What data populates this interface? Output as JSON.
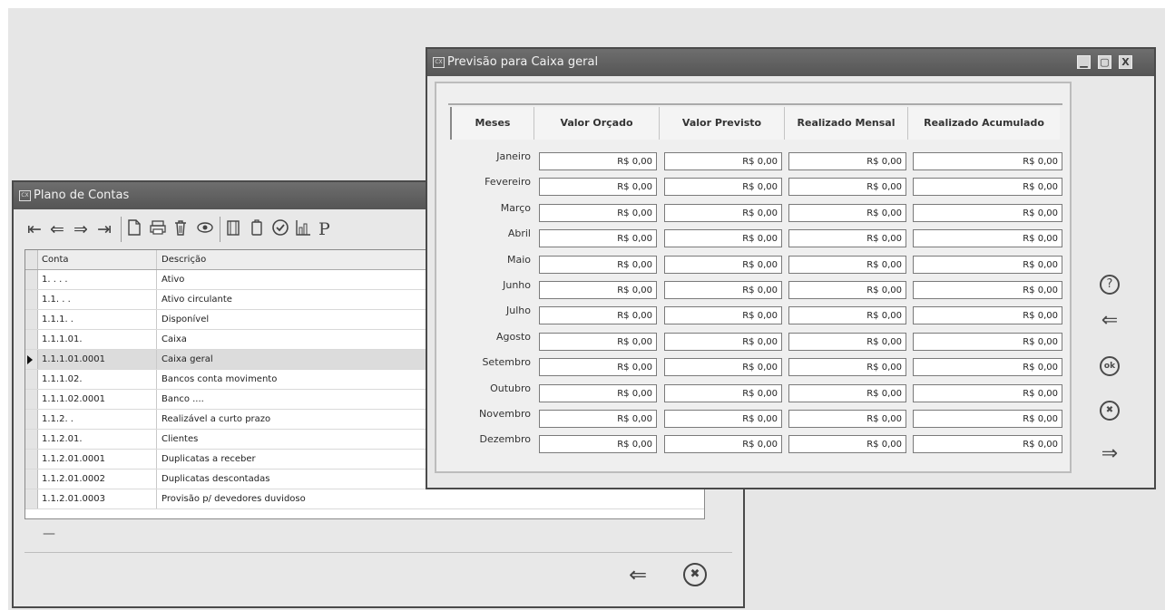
{
  "plano": {
    "title": "Plano de Contas",
    "columns": {
      "conta": "Conta",
      "descricao": "Descrição"
    },
    "rows": [
      {
        "conta": "1. . . .",
        "descricao": "Ativo"
      },
      {
        "conta": "1.1. . .",
        "descricao": "Ativo circulante"
      },
      {
        "conta": "1.1.1. .",
        "descricao": "Disponível"
      },
      {
        "conta": "1.1.1.01.",
        "descricao": "Caixa"
      },
      {
        "conta": "1.1.1.01.0001",
        "descricao": "Caixa geral"
      },
      {
        "conta": "1.1.1.02.",
        "descricao": "Bancos conta movimento"
      },
      {
        "conta": "1.1.1.02.0001",
        "descricao": "Banco ...."
      },
      {
        "conta": "1.1.2. .",
        "descricao": "Realizável a curto prazo"
      },
      {
        "conta": "1.1.2.01.",
        "descricao": "Clientes"
      },
      {
        "conta": "1.1.2.01.0001",
        "descricao": "Duplicatas a receber"
      },
      {
        "conta": "1.1.2.01.0002",
        "descricao": "Duplicatas descontadas"
      },
      {
        "conta": "1.1.2.01.0003",
        "descricao": "Provisão p/ devedores duvidoso"
      }
    ],
    "selected_index": 4,
    "toolbar_p": "P",
    "footer_dash": "—"
  },
  "previsao": {
    "title": "Previsão para Caixa geral",
    "headers": {
      "meses": "Meses",
      "orcado": "Valor Orçado",
      "previsto": "Valor Previsto",
      "mensal": "Realizado Mensal",
      "acumulado": "Realizado Acumulado"
    },
    "months": [
      {
        "name": "Janeiro",
        "orcado": "R$ 0,00",
        "previsto": "R$ 0,00",
        "mensal": "R$ 0,00",
        "acumulado": "R$ 0,00"
      },
      {
        "name": "Fevereiro",
        "orcado": "R$ 0,00",
        "previsto": "R$ 0,00",
        "mensal": "R$ 0,00",
        "acumulado": "R$ 0,00"
      },
      {
        "name": "Março",
        "orcado": "R$ 0,00",
        "previsto": "R$ 0,00",
        "mensal": "R$ 0,00",
        "acumulado": "R$ 0,00"
      },
      {
        "name": "Abril",
        "orcado": "R$ 0,00",
        "previsto": "R$ 0,00",
        "mensal": "R$ 0,00",
        "acumulado": "R$ 0,00"
      },
      {
        "name": "Maio",
        "orcado": "R$ 0,00",
        "previsto": "R$ 0,00",
        "mensal": "R$ 0,00",
        "acumulado": "R$ 0,00"
      },
      {
        "name": "Junho",
        "orcado": "R$ 0,00",
        "previsto": "R$ 0,00",
        "mensal": "R$ 0,00",
        "acumulado": "R$ 0,00"
      },
      {
        "name": "Julho",
        "orcado": "R$ 0,00",
        "previsto": "R$ 0,00",
        "mensal": "R$ 0,00",
        "acumulado": "R$ 0,00"
      },
      {
        "name": "Agosto",
        "orcado": "R$ 0,00",
        "previsto": "R$ 0,00",
        "mensal": "R$ 0,00",
        "acumulado": "R$ 0,00"
      },
      {
        "name": "Setembro",
        "orcado": "R$ 0,00",
        "previsto": "R$ 0,00",
        "mensal": "R$ 0,00",
        "acumulado": "R$ 0,00"
      },
      {
        "name": "Outubro",
        "orcado": "R$ 0,00",
        "previsto": "R$ 0,00",
        "mensal": "R$ 0,00",
        "acumulado": "R$ 0,00"
      },
      {
        "name": "Novembro",
        "orcado": "R$ 0,00",
        "previsto": "R$ 0,00",
        "mensal": "R$ 0,00",
        "acumulado": "R$ 0,00"
      },
      {
        "name": "Dezembro",
        "orcado": "R$ 0,00",
        "previsto": "R$ 0,00",
        "mensal": "R$ 0,00",
        "acumulado": "R$ 0,00"
      }
    ]
  },
  "icons": {
    "first": "⇤",
    "prev": "⇐",
    "next": "⇒",
    "last": "⇥",
    "help": "?",
    "ok": "ok",
    "cancel": "✖",
    "minimize": "▁",
    "maximize": "▢",
    "close": "X"
  }
}
